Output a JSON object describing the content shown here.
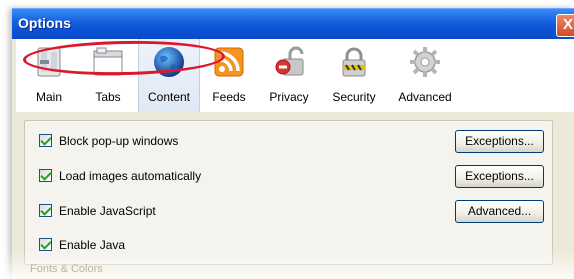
{
  "window": {
    "title": "Options",
    "close_label": "X"
  },
  "toolbar": {
    "items": [
      {
        "label": "Main",
        "icon": "main-switch-icon"
      },
      {
        "label": "Tabs",
        "icon": "tabs-window-icon"
      },
      {
        "label": "Content",
        "icon": "globe-icon",
        "selected": true
      },
      {
        "label": "Feeds",
        "icon": "rss-feed-icon"
      },
      {
        "label": "Privacy",
        "icon": "privacy-lock-icon"
      },
      {
        "label": "Security",
        "icon": "security-padlock-icon"
      },
      {
        "label": "Advanced",
        "icon": "gear-icon"
      }
    ]
  },
  "content": {
    "rows": [
      {
        "label": "Block pop-up windows",
        "checked": true,
        "button": "Exceptions..."
      },
      {
        "label": "Load images automatically",
        "checked": true,
        "button": "Exceptions..."
      },
      {
        "label": "Enable JavaScript",
        "checked": true,
        "button": "Advanced..."
      },
      {
        "label": "Enable Java",
        "checked": true
      }
    ],
    "next_section_label": "Fonts & Colors"
  },
  "annotation": {
    "color": "#e0162b"
  }
}
